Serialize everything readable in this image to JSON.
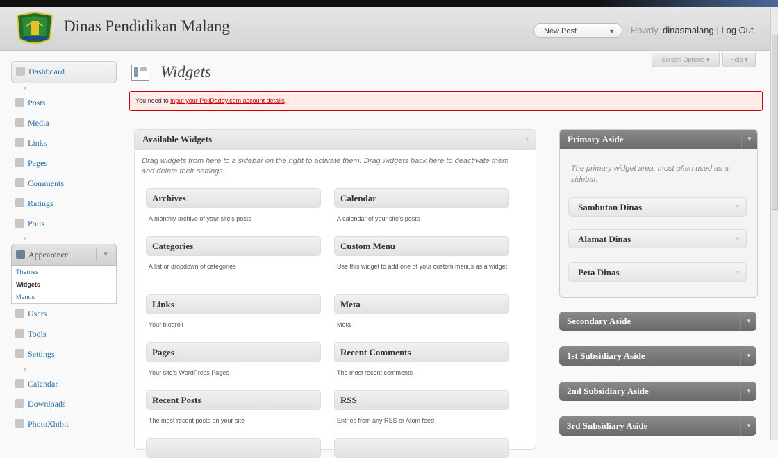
{
  "header": {
    "site_title": "Dinas Pendidikan Malang",
    "new_post": "New Post",
    "howdy": "Howdy,",
    "username": "dinasmalang",
    "separator": "|",
    "logout": "Log Out",
    "screen_options": "Screen Options ▾",
    "help": "Help ▾"
  },
  "sidebar": {
    "items_top": [
      {
        "label": "Dashboard",
        "icon": "house-icon"
      }
    ],
    "items_mid": [
      {
        "label": "Posts",
        "icon": "pin-icon"
      },
      {
        "label": "Media",
        "icon": "media-icon"
      },
      {
        "label": "Links",
        "icon": "link-icon"
      },
      {
        "label": "Pages",
        "icon": "page-icon"
      },
      {
        "label": "Comments",
        "icon": "comment-icon"
      },
      {
        "label": "Ratings",
        "icon": "rating-icon"
      },
      {
        "label": "Polls",
        "icon": "poll-icon"
      }
    ],
    "appearance": {
      "label": "Appearance",
      "submenu": [
        "Themes",
        "Widgets",
        "Menus"
      ]
    },
    "items_bottom": [
      {
        "label": "Users",
        "icon": "users-icon"
      },
      {
        "label": "Tools",
        "icon": "tools-icon"
      },
      {
        "label": "Settings",
        "icon": "settings-icon"
      }
    ],
    "items_plugins": [
      {
        "label": "Calendar",
        "icon": "calendar-icon"
      },
      {
        "label": "Downloads",
        "icon": "download-icon"
      },
      {
        "label": "PhotoXhibit",
        "icon": "photo-icon"
      }
    ]
  },
  "main": {
    "title": "Widgets",
    "notice_prefix": "You need to ",
    "notice_link": "input your PollDaddy.com account details",
    "notice_suffix": ".",
    "available": {
      "title": "Available Widgets",
      "description": "Drag widgets from here to a sidebar on the right to activate them. Drag widgets back here to deactivate them and delete their settings.",
      "widgets": [
        {
          "name": "Archives",
          "desc": "A monthly archive of your site's posts"
        },
        {
          "name": "Calendar",
          "desc": "A calendar of your site's posts"
        },
        {
          "name": "Categories",
          "desc": "A list or dropdown of categories"
        },
        {
          "name": "Custom Menu",
          "desc": "Use this widget to add one of your custom menus as a widget."
        },
        {
          "name": "Links",
          "desc": "Your blogroll"
        },
        {
          "name": "Meta",
          "desc": "Meta"
        },
        {
          "name": "Pages",
          "desc": "Your site's WordPress Pages"
        },
        {
          "name": "Recent Comments",
          "desc": "The most recent comments"
        },
        {
          "name": "Recent Posts",
          "desc": "The most recent posts on your site"
        },
        {
          "name": "RSS",
          "desc": "Entries from any RSS or Atom feed"
        }
      ]
    },
    "primary": {
      "title": "Primary Aside",
      "description": "The primary widget area, most often used as a sidebar.",
      "widgets": [
        "Sambutan Dinas",
        "Alamat Dinas",
        "Peta Dinas"
      ]
    },
    "other_areas": [
      "Secondary Aside",
      "1st Subsidiary Aside",
      "2nd Subsidiary Aside",
      "3rd Subsidiary Aside"
    ]
  }
}
